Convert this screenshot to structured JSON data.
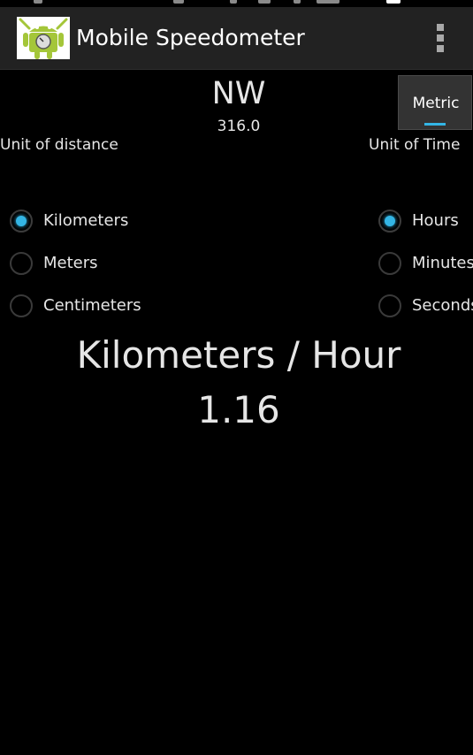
{
  "app": {
    "title": "Mobile Speedometer",
    "icon": "android-speedometer-icon",
    "menu_icon": "overflow-menu-icon"
  },
  "compass": {
    "direction": "NW",
    "bearing": "316.0"
  },
  "tabs": {
    "metric_label": "Metric"
  },
  "distance": {
    "label": "Unit of distance",
    "options": [
      {
        "label": "Kilometers",
        "checked": true
      },
      {
        "label": "Meters",
        "checked": false
      },
      {
        "label": "Centimeters",
        "checked": false
      }
    ]
  },
  "time": {
    "label": "Unit of Time",
    "options": [
      {
        "label": "Hours",
        "checked": true
      },
      {
        "label": "Minutes",
        "checked": false
      },
      {
        "label": "Seconds",
        "checked": false
      }
    ]
  },
  "speed": {
    "unit": "Kilometers / Hour",
    "value": "1.16"
  },
  "colors": {
    "accent": "#33b5e5",
    "action_bar": "#222222",
    "background": "#000000",
    "text": "#e6e6e6"
  }
}
